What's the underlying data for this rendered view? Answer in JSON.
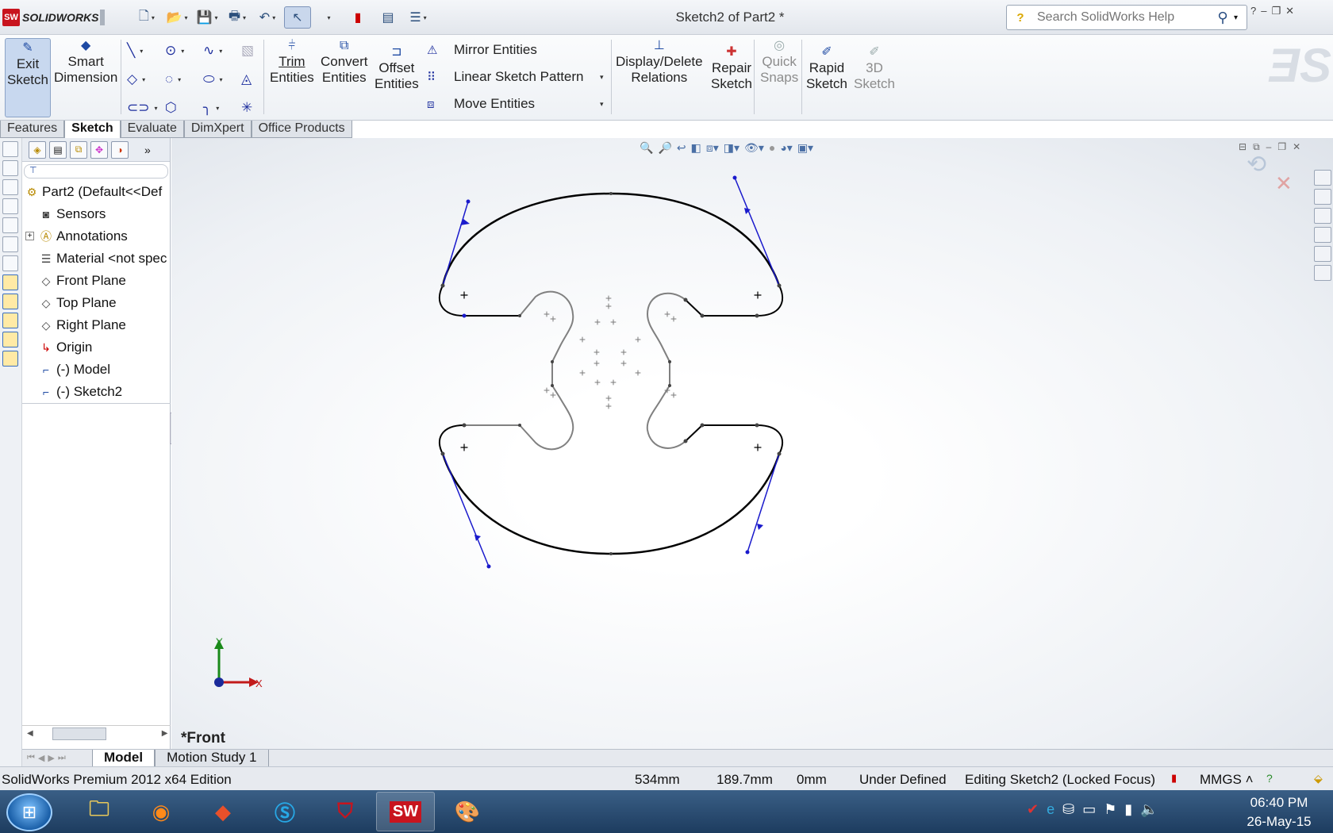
{
  "app": {
    "logo_text": "SOLIDWORKS",
    "logo_badge": "SW",
    "document_title": "Sketch2 of Part2 *"
  },
  "help_search": {
    "placeholder": "Search SolidWorks Help",
    "icon": "question-bubble-icon"
  },
  "window_controls": [
    "?",
    "–",
    "❐",
    "✕"
  ],
  "ribbon": {
    "exit_sketch": [
      "Exit",
      "Sketch"
    ],
    "smart_dimension": [
      "Smart",
      "Dimension"
    ],
    "trim_entities": [
      "Trim",
      "Entities"
    ],
    "convert_entities": [
      "Convert",
      "Entities"
    ],
    "offset_entities": [
      "Offset",
      "Entities"
    ],
    "mirror_entities": "Mirror Entities",
    "linear_sketch_pattern": "Linear Sketch Pattern",
    "move_entities": "Move Entities",
    "display_delete_relations": [
      "Display/Delete",
      "Relations"
    ],
    "repair_sketch": [
      "Repair",
      "Sketch"
    ],
    "quick_snaps": [
      "Quick",
      "Snaps"
    ],
    "rapid_sketch": [
      "Rapid",
      "Sketch"
    ],
    "sketch_3d": [
      "3D",
      "Sketch"
    ]
  },
  "command_tabs": [
    {
      "label": "Features",
      "active": false
    },
    {
      "label": "Sketch",
      "active": true
    },
    {
      "label": "Evaluate",
      "active": false
    },
    {
      "label": "DimXpert",
      "active": false
    },
    {
      "label": "Office Products",
      "active": false
    }
  ],
  "feature_tree": {
    "root": "Part2  (Default<<Def",
    "items": [
      {
        "label": "Sensors",
        "icon": "sensor-icon"
      },
      {
        "label": "Annotations",
        "icon": "annotation-icon",
        "expandable": true
      },
      {
        "label": "Material <not spec",
        "icon": "material-icon"
      },
      {
        "label": "Front Plane",
        "icon": "plane-icon"
      },
      {
        "label": "Top Plane",
        "icon": "plane-icon"
      },
      {
        "label": "Right Plane",
        "icon": "plane-icon"
      },
      {
        "label": "Origin",
        "icon": "origin-icon"
      },
      {
        "label": "(-) Model",
        "icon": "sketch-icon"
      },
      {
        "label": "(-) Sketch2",
        "icon": "sketch-icon"
      }
    ]
  },
  "viewport": {
    "view_name": "*Front",
    "triad_x": "X",
    "triad_y": "Y"
  },
  "model_tabs": [
    {
      "label": "Model",
      "active": true
    },
    {
      "label": "Motion Study 1",
      "active": false
    }
  ],
  "status_bar": {
    "edition": "SolidWorks Premium 2012 x64 Edition",
    "x": "534mm",
    "y": "189.7mm",
    "z": "0mm",
    "state": "Under Defined",
    "editing": "Editing Sketch2 (Locked Focus)",
    "units": "MMGS ˄"
  },
  "taskbar": {
    "apps": [
      "file-explorer-icon",
      "firefox-icon",
      "git-icon",
      "skype-icon",
      "mcafee-icon",
      "solidworks-icon",
      "paint-icon"
    ],
    "time": "06:40 PM",
    "date": "26-May-15"
  },
  "colors": {
    "sketch_defined": "#000000",
    "sketch_underdefined": "#808080",
    "spline_handle": "#1a1acc",
    "accent": "#1e4aa3"
  }
}
